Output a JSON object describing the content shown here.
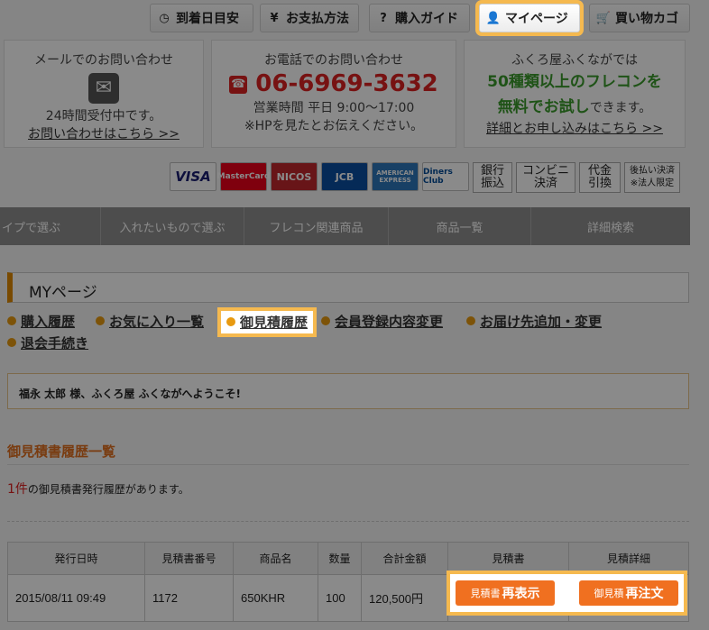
{
  "nav": {
    "items": [
      {
        "label": "到着日目安",
        "icon": "clock-icon"
      },
      {
        "label": "お支払方法",
        "icon": "yen-icon"
      },
      {
        "label": "購入ガイド",
        "icon": "question-icon"
      },
      {
        "label": "マイページ",
        "icon": "user-icon"
      },
      {
        "label": "買い物カゴ",
        "icon": "cart-icon"
      }
    ]
  },
  "contact": {
    "mail": {
      "title": "メールでのお問い合わせ",
      "hours": "24時間受付中です。",
      "link": "お問い合わせはこちら >>"
    },
    "phone": {
      "title": "お電話でのお問い合わせ",
      "number": "06-6969-3632",
      "hours": "営業時間 平日 9:00〜17:00",
      "note": "※HPを見たとお伝えください。"
    },
    "sample": {
      "title": "ふくろ屋ふくながでは",
      "line1": "50種類以上のフレコンを",
      "line2a": "無料でお試し",
      "line2b": "できます。",
      "link": "詳細とお申し込みはこちら >>"
    }
  },
  "payment": {
    "cards": [
      "VISA",
      "MasterCard",
      "NICOS",
      "JCB",
      "AMERICAN EXPRESS",
      "Diners Club"
    ],
    "methods": [
      "銀行\n振込",
      "コンビニ\n決済",
      "代金\n引換",
      "後払い決済\n※法人限定"
    ]
  },
  "categories": [
    "イプで選ぶ",
    "入れたいもので選ぶ",
    "フレコン関連商品",
    "商品一覧",
    "詳細検索"
  ],
  "mypage": {
    "title": "MYページ",
    "links": [
      "購入履歴",
      "お気に入り一覧",
      "御見積履歴",
      "会員登録内容変更",
      "お届け先追加・変更",
      "退会手続き"
    ],
    "welcome": "福永 太郎 様、ふくろ屋 ふくながへようこそ!"
  },
  "history": {
    "heading": "御見積書履歴一覧",
    "count": "1件",
    "count_text": "の御見積書発行履歴があります。",
    "columns": [
      "発行日時",
      "見積書番号",
      "商品名",
      "数量",
      "合計金額",
      "見積書",
      "見積詳細"
    ],
    "rows": [
      {
        "date": "2015/08/11 09:49",
        "number": "1172",
        "product": "650KHR",
        "qty": "100",
        "total": "120,500円"
      }
    ],
    "btn_reshow_small": "見積書",
    "btn_reshow": "再表示",
    "btn_reorder_small": "御見積",
    "btn_reorder": "再注文"
  },
  "colors": {
    "accent": "#f07020",
    "highlight": "#f5b94f",
    "phone": "#d22222",
    "green": "#3a9a2c"
  }
}
